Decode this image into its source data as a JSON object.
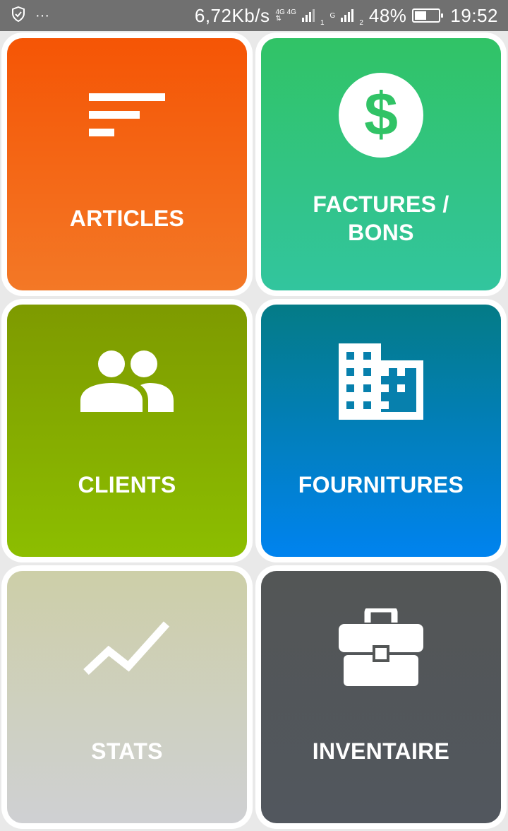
{
  "status_bar": {
    "net_speed": "6,72Kb/s",
    "sim1_label_top": "4G 4G",
    "sim1_index": "1",
    "sim2_label": "G",
    "sim2_index": "2",
    "battery": "48%",
    "battery_level": 0.48,
    "time": "19:52",
    "left_icons": [
      "shield-check-icon",
      "more-dots-icon"
    ]
  },
  "tiles": [
    {
      "label": "ARTICLES",
      "icon": "sort-lines-icon",
      "color_top": "#f55505",
      "color_bottom": "#f37826"
    },
    {
      "label": "FACTURES / BONS",
      "icon": "dollar-circle-icon",
      "color_top": "#31c366",
      "color_bottom": "#32c59e"
    },
    {
      "label": "CLIENTS",
      "icon": "people-icon",
      "color_top": "#7e9a00",
      "color_bottom": "#8cbe00"
    },
    {
      "label": "FOURNITURES",
      "icon": "building-icon",
      "color_top": "#047b86",
      "color_bottom": "#0083ef"
    },
    {
      "label": "STATS",
      "icon": "trending-line-icon",
      "color_top": "#cdcfa8",
      "color_bottom": "#cfd0d3"
    },
    {
      "label": "INVENTAIRE",
      "icon": "briefcase-icon",
      "color_top": "#535656",
      "color_bottom": "#52575e"
    }
  ]
}
